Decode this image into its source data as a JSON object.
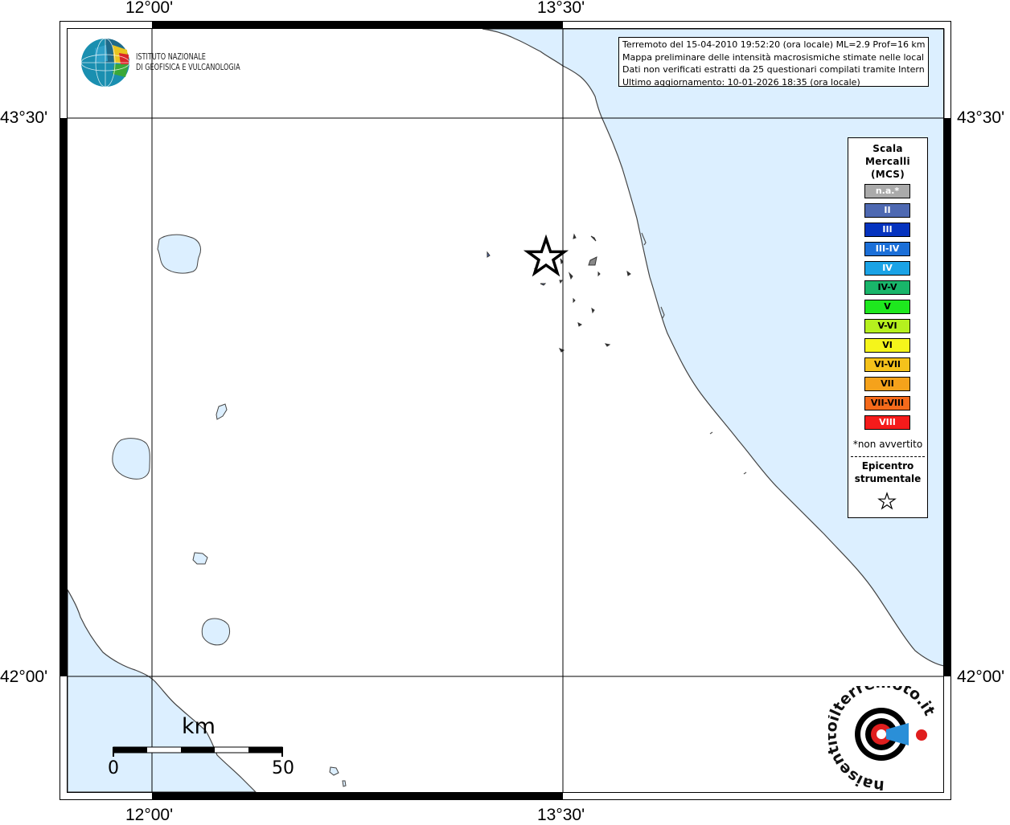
{
  "map": {
    "lon_labels": [
      "12°00'",
      "13°30'"
    ],
    "lat_labels": [
      "43°30'",
      "42°00'"
    ],
    "colors": {
      "sea": "#dcefff",
      "land": "#ffffff",
      "coast": "#444444",
      "frame": "#000000"
    }
  },
  "logo": {
    "line1": "ISTITUTO NAZIONALE",
    "line2": "DI GEOFISICA E VULCANOLOGIA"
  },
  "info": {
    "line1": "Terremoto del 15-04-2010 19:52:20 (ora locale) ML=2.9 Prof=16 km",
    "line2": "Mappa preliminare delle intensità macrosismiche stimate nelle località",
    "line3": "Dati non verificati estratti da 25 questionari compilati tramite Internet.",
    "line4": "Ultimo aggiornamento: 10-01-2026 18:35 (ora locale)"
  },
  "legend": {
    "title1": "Scala",
    "title2": "Mercalli",
    "title3": "(MCS)",
    "items": [
      {
        "label": "n.a.*",
        "color": "#aaaaaa",
        "text_color": "#ffffff"
      },
      {
        "label": "II",
        "color": "#4e69b2",
        "text_color": "#ffffff"
      },
      {
        "label": "III",
        "color": "#0533bf",
        "text_color": "#ffffff"
      },
      {
        "label": "III-IV",
        "color": "#1b6fd8",
        "text_color": "#ffffff"
      },
      {
        "label": "IV",
        "color": "#1aa3e6",
        "text_color": "#ffffff"
      },
      {
        "label": "IV-V",
        "color": "#19b56a",
        "text_color": "#000000"
      },
      {
        "label": "V",
        "color": "#1ee81e",
        "text_color": "#000000"
      },
      {
        "label": "V-VI",
        "color": "#b5f01e",
        "text_color": "#000000"
      },
      {
        "label": "VI",
        "color": "#f5f51b",
        "text_color": "#000000"
      },
      {
        "label": "VI-VII",
        "color": "#f5c21b",
        "text_color": "#000000"
      },
      {
        "label": "VII",
        "color": "#f5a21b",
        "text_color": "#000000"
      },
      {
        "label": "VII-VIII",
        "color": "#f56a1b",
        "text_color": "#000000"
      },
      {
        "label": "VIII",
        "color": "#f51b1b",
        "text_color": "#ffffff"
      }
    ],
    "note": "*non avvertito",
    "epicenter1": "Epicentro",
    "epicenter2": "strumentale"
  },
  "scale_bar": {
    "unit": "km",
    "start": "0",
    "end": "50"
  },
  "haisentito": {
    "text": "haisentitoilterremoto.it"
  }
}
